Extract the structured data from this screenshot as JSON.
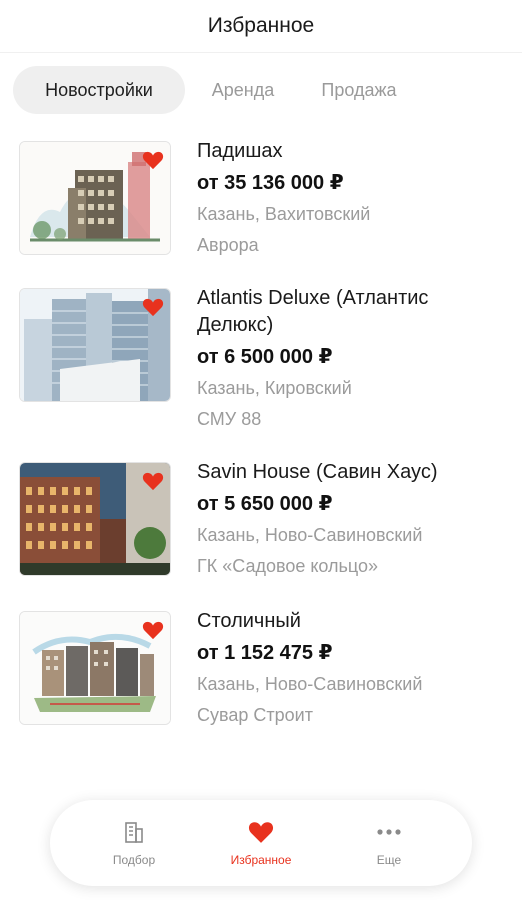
{
  "header": {
    "title": "Избранное"
  },
  "tabs": [
    {
      "label": "Новостройки",
      "active": true
    },
    {
      "label": "Аренда",
      "active": false
    },
    {
      "label": "Продажа",
      "active": false
    }
  ],
  "items": [
    {
      "name": "Падишах",
      "price": "от 35 136 000 ₽",
      "location": "Казань, Вахитовский",
      "developer": "Аврора",
      "favorite": true
    },
    {
      "name": "Atlantis Deluxe (Атлантис Делюкс)",
      "price": "от 6 500 000 ₽",
      "location": "Казань, Кировский",
      "developer": "СМУ 88",
      "favorite": true
    },
    {
      "name": "Savin House (Савин Хаус)",
      "price": "от 5 650 000 ₽",
      "location": "Казань, Ново-Савиновский",
      "developer": "ГК «Садовое кольцо»",
      "favorite": true
    },
    {
      "name": "Столичный",
      "price": "от 1 152 475 ₽",
      "location": "Казань, Ново-Савиновский",
      "developer": "Сувар Строит",
      "favorite": true
    }
  ],
  "nav": [
    {
      "label": "Подбор",
      "icon": "building-icon",
      "active": false
    },
    {
      "label": "Избранное",
      "icon": "heart-icon",
      "active": true
    },
    {
      "label": "Еще",
      "icon": "more-dots-icon",
      "active": false
    }
  ],
  "colors": {
    "accent": "#e8321e",
    "text": "#1a1a1a",
    "muted": "#9b9b9b",
    "tab_bg": "#efefef"
  }
}
